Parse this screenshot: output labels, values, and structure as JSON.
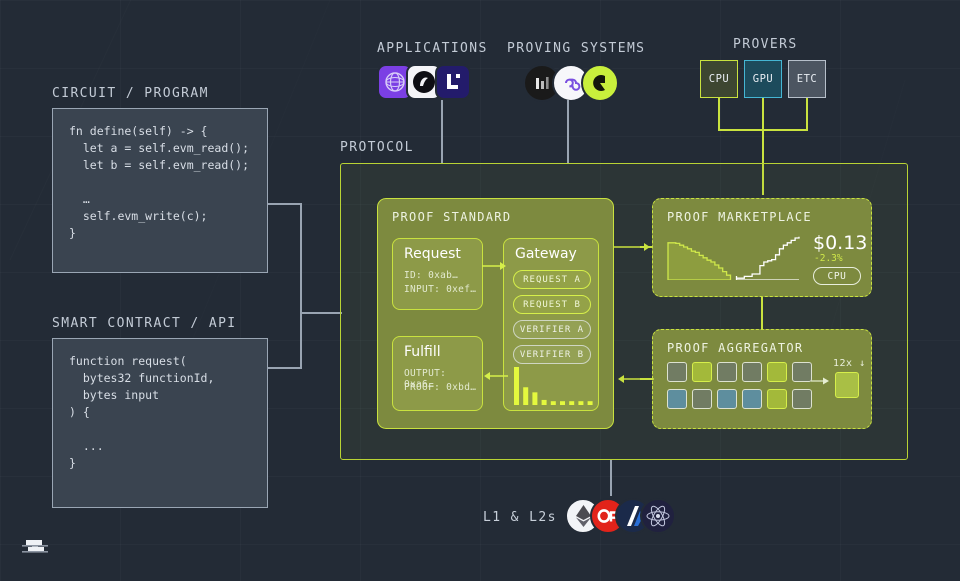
{
  "page": {
    "background": "#232b36",
    "accent": "#c9e23f",
    "panel_green": "#7d8a3f"
  },
  "left_column": {
    "circuit": {
      "label": "CIRCUIT / PROGRAM",
      "code": "fn define(self) -> {\n  let a = self.evm_read();\n  let b = self.evm_read();\n\n  …\n  self.evm_write(c);\n}"
    },
    "contract": {
      "label": "SMART CONTRACT / API",
      "code": "function request(\n  bytes32 functionId,\n  bytes input\n) {\n\n  ...\n}"
    }
  },
  "top": {
    "applications": {
      "label": "APPLICATIONS",
      "icons": [
        {
          "name": "app-icon-globe",
          "bg": "#7b3fe4",
          "fg": "#d6c8f7"
        },
        {
          "name": "app-icon-white",
          "bg": "#f4f4f8",
          "fg": "#12121a"
        },
        {
          "name": "app-icon-lens",
          "bg": "#231b6b",
          "fg": "#ffffff"
        }
      ]
    },
    "proving_systems": {
      "label": "PROVING SYSTEMS",
      "icons": [
        {
          "name": "proving-icon-dark",
          "bg": "#1a1a1a",
          "fg": "#e9e9e9"
        },
        {
          "name": "proving-icon-infinity",
          "bg": "#f7f7fa",
          "fg": "#7a4fe0"
        },
        {
          "name": "proving-icon-lime",
          "bg": "#c9ef3c",
          "fg": "#11140b"
        }
      ]
    },
    "provers": {
      "label": "PROVERS",
      "items": [
        {
          "label": "CPU",
          "border": "#c9e23f",
          "bg": "#3d4631"
        },
        {
          "label": "GPU",
          "border": "#45b6d4",
          "bg": "#1d4b5c"
        },
        {
          "label": "ETC",
          "border": "#b6bfca",
          "bg": "#4c5561"
        }
      ]
    }
  },
  "protocol": {
    "label": "PROTOCOL",
    "proof_standard": {
      "title": "PROOF STANDARD",
      "request": {
        "heading": "Request",
        "rows": [
          "ID: 0xab…",
          "INPUT: 0xef…"
        ]
      },
      "fulfill": {
        "heading": "Fulfill",
        "rows": [
          "OUTPUT: 0xa6…",
          "PROOF: 0xbd…"
        ]
      },
      "gateway": {
        "heading": "Gateway",
        "pills": [
          {
            "label": "REQUEST A",
            "style": "y"
          },
          {
            "label": "REQUEST B",
            "style": "y"
          },
          {
            "label": "VERIFIER A",
            "style": "g"
          },
          {
            "label": "VERIFIER B",
            "style": "g"
          }
        ],
        "bars": [
          30,
          14,
          10,
          4,
          3,
          3,
          3,
          3,
          3
        ]
      }
    },
    "marketplace": {
      "title": "PROOF MARKETPLACE",
      "price": "$0.13",
      "delta": "-2.3%",
      "tag": "CPU",
      "chart": {
        "type": "area",
        "series": [
          {
            "name": "falling",
            "values": [
              62,
              62,
              61,
              58,
              55,
              52,
              48,
              46,
              41,
              37,
              33,
              30,
              25,
              20,
              14,
              8,
              3
            ]
          },
          {
            "name": "rising",
            "values": [
              3,
              3,
              6,
              6,
              10,
              10,
              24,
              30,
              32,
              34,
              42,
              52,
              58,
              62,
              66,
              70,
              72
            ]
          }
        ]
      }
    },
    "aggregator": {
      "title": "PROOF AGGREGATOR",
      "multiplier": "12x",
      "grid": [
        [
          "gray",
          "green",
          "gray",
          "gray",
          "green",
          "gray"
        ],
        [
          "blue",
          "gray",
          "blue",
          "blue",
          "green",
          "gray"
        ]
      ],
      "colors": {
        "gray": "#717c63",
        "green": "#a3b93a",
        "blue": "#5e8e9e",
        "output": "#a9bf45"
      }
    }
  },
  "bottom": {
    "label": "L1 & L2s",
    "icons": [
      {
        "name": "chain-icon-ethereum",
        "bg": "#f2f4f7",
        "fg": "#3c3c3d"
      },
      {
        "name": "chain-icon-optimism",
        "bg": "#e2231a",
        "fg": "#ffffff"
      },
      {
        "name": "chain-icon-arbitrum",
        "bg": "#1b2a4a",
        "fg": "#ffffff"
      },
      {
        "name": "chain-icon-cosmos",
        "bg": "#20213f",
        "fg": "#d8dbec"
      }
    ]
  },
  "logo": {
    "name": "succinct-logo"
  }
}
